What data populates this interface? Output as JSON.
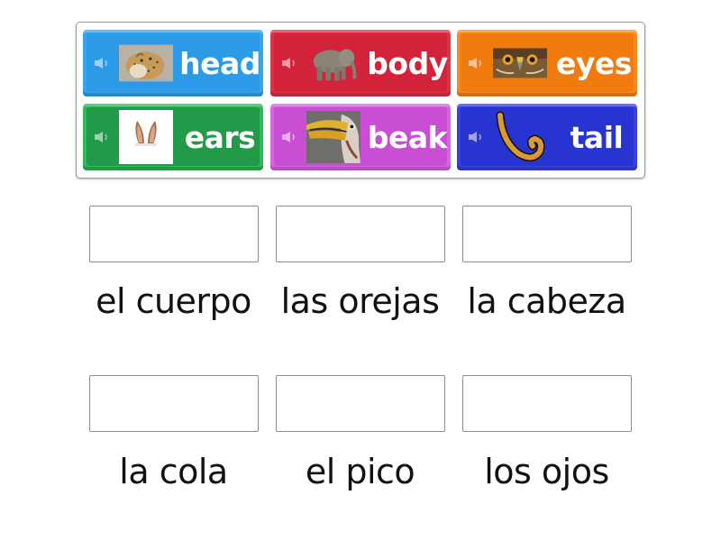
{
  "tiles": [
    {
      "word": "head",
      "image": "cheetah-head",
      "color": "#2d9ae8"
    },
    {
      "word": "body",
      "image": "elephant",
      "color": "#d2233b"
    },
    {
      "word": "eyes",
      "image": "hawk-eyes",
      "color": "#f07c10"
    },
    {
      "word": "ears",
      "image": "rabbit-ears",
      "color": "#239a4a"
    },
    {
      "word": "beak",
      "image": "hornbill-beak",
      "color": "#c84fd4"
    },
    {
      "word": "tail",
      "image": "leopard-tail",
      "color": "#2834cf"
    }
  ],
  "targets": [
    {
      "label": "el cuerpo"
    },
    {
      "label": "las orejas"
    },
    {
      "label": "la cabeza"
    },
    {
      "label": "la cola"
    },
    {
      "label": "el pico"
    },
    {
      "label": "los ojos"
    }
  ]
}
